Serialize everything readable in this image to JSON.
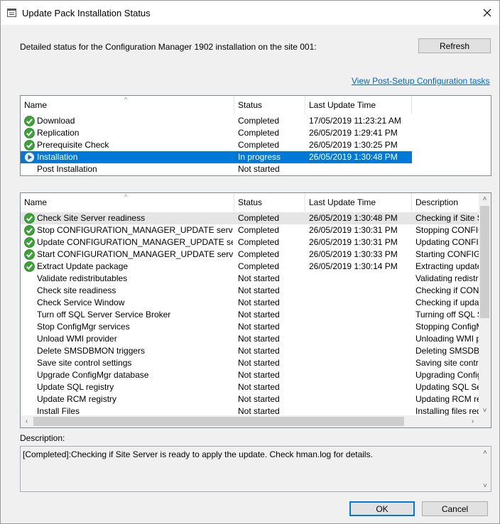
{
  "window": {
    "title": "Update Pack Installation Status",
    "header_text": "Detailed status for the Configuration Manager 1902 installation on the site 001:",
    "refresh_label": "Refresh",
    "post_setup_link": "View Post-Setup Configuration tasks",
    "ok_label": "OK",
    "cancel_label": "Cancel"
  },
  "top_list": {
    "columns": [
      "Name",
      "Status",
      "Last Update Time"
    ],
    "rows": [
      {
        "name": "Download",
        "status": "Completed",
        "time": "17/05/2019 11:23:21 AM",
        "icon": "completed-check-icon"
      },
      {
        "name": "Replication",
        "status": "Completed",
        "time": "26/05/2019 1:29:41 PM",
        "icon": "completed-check-icon"
      },
      {
        "name": "Prerequisite Check",
        "status": "Completed",
        "time": "26/05/2019 1:30:25 PM",
        "icon": "completed-check-icon"
      },
      {
        "name": "Installation",
        "status": "In progress",
        "time": "26/05/2019 1:30:48 PM",
        "icon": "in-progress-play-icon"
      },
      {
        "name": "Post Installation",
        "status": "Not started",
        "time": "",
        "icon": ""
      }
    ]
  },
  "bottom_list": {
    "columns": [
      "Name",
      "Status",
      "Last Update Time",
      "Description"
    ],
    "rows": [
      {
        "name": "Check Site Server readiness",
        "status": "Completed",
        "time": "26/05/2019 1:30:48 PM",
        "desc": "Checking if Site Se",
        "icon": "completed-check-icon"
      },
      {
        "name": "Stop CONFIGURATION_MANAGER_UPDATE service",
        "status": "Completed",
        "time": "26/05/2019 1:30:31 PM",
        "desc": "Stopping CONFIGU",
        "icon": "completed-check-icon"
      },
      {
        "name": "Update CONFIGURATION_MANAGER_UPDATE service",
        "status": "Completed",
        "time": "26/05/2019 1:30:31 PM",
        "desc": "Updating CONFIG",
        "icon": "completed-check-icon"
      },
      {
        "name": "Start CONFIGURATION_MANAGER_UPDATE service",
        "status": "Completed",
        "time": "26/05/2019 1:30:33 PM",
        "desc": "Starting CONFIGU",
        "icon": "completed-check-icon"
      },
      {
        "name": "Extract Update package",
        "status": "Completed",
        "time": "26/05/2019 1:30:14 PM",
        "desc": "Extracting update p",
        "icon": "completed-check-icon"
      },
      {
        "name": "Validate redistributables",
        "status": "Not started",
        "time": "",
        "desc": "Validating redistrib",
        "icon": ""
      },
      {
        "name": "Check site readiness",
        "status": "Not started",
        "time": "",
        "desc": "Checking if CONFI",
        "icon": ""
      },
      {
        "name": "Check Service Window",
        "status": "Not started",
        "time": "",
        "desc": "Checking if update",
        "icon": ""
      },
      {
        "name": "Turn off SQL Server Service Broker",
        "status": "Not started",
        "time": "",
        "desc": "Turning off SQL Se",
        "icon": ""
      },
      {
        "name": "Stop ConfigMgr services",
        "status": "Not started",
        "time": "",
        "desc": "Stopping ConfigMg",
        "icon": ""
      },
      {
        "name": "Unload WMI provider",
        "status": "Not started",
        "time": "",
        "desc": "Unloading WMI pro",
        "icon": ""
      },
      {
        "name": "Delete SMSDBMON triggers",
        "status": "Not started",
        "time": "",
        "desc": "Deleting SMSDBM",
        "icon": ""
      },
      {
        "name": "Save site control settings",
        "status": "Not started",
        "time": "",
        "desc": "Saving site control",
        "icon": ""
      },
      {
        "name": "Upgrade ConfigMgr database",
        "status": "Not started",
        "time": "",
        "desc": "Upgrading ConfigM",
        "icon": ""
      },
      {
        "name": "Update SQL registry",
        "status": "Not started",
        "time": "",
        "desc": "Updating SQL Ser",
        "icon": ""
      },
      {
        "name": "Update RCM registry",
        "status": "Not started",
        "time": "",
        "desc": "Updating RCM reg",
        "icon": ""
      },
      {
        "name": "Install Files",
        "status": "Not started",
        "time": "",
        "desc": "Installing files requi",
        "icon": ""
      }
    ]
  },
  "description": {
    "label": "Description:",
    "text": "[Completed]:Checking if Site Server is ready to apply the update. Check hman.log for details."
  },
  "colors": {
    "selection": "#0078d7",
    "completed_icon": "#3aa335",
    "link": "#0066cc"
  }
}
